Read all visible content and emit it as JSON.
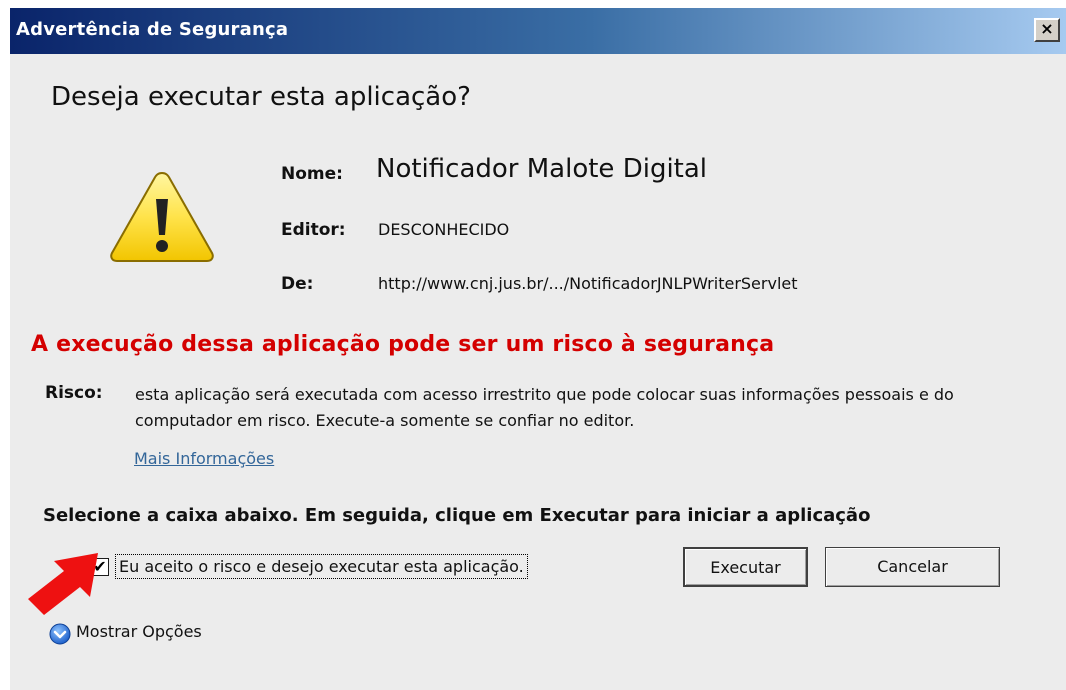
{
  "window": {
    "title": "Advertência de Segurança",
    "close_label": "×"
  },
  "dialog": {
    "question": "Deseja executar esta aplicação?",
    "name_label": "Nome:",
    "name_value": "Notificador Malote Digital",
    "publisher_label": "Editor:",
    "publisher_value": "DESCONHECIDO",
    "from_label": "De:",
    "from_value": "http://www.cnj.jus.br/.../NotificadorJNLPWriterServlet",
    "risk_heading": "A execução dessa aplicação pode ser um risco à segurança",
    "risk_label": "Risco:",
    "risk_text": "esta aplicação será executada com acesso irrestrito que pode colocar suas informações pessoais e do computador em risco. Execute-a somente se confiar no editor.",
    "more_info_link": "Mais Informações",
    "instruction": "Selecione a caixa abaixo. Em seguida, clique em Executar para iniciar a aplicação",
    "accept_checkbox_label": "Eu aceito o risco e desejo executar esta aplicação.",
    "accept_checkbox_checked": true,
    "run_button": "Executar",
    "cancel_button": "Cancelar",
    "show_options": "Mostrar Opções"
  },
  "colors": {
    "title_gradient_start": "#0a246a",
    "title_gradient_end": "#a6caf0",
    "risk_heading": "#d40000",
    "link": "#336699",
    "dialog_bg": "#ececec",
    "annotation_arrow": "#ee1111"
  },
  "icons": {
    "warning": "warning-triangle-icon",
    "show_options": "chevron-down-circle-icon",
    "annotation": "red-arrow-icon"
  }
}
